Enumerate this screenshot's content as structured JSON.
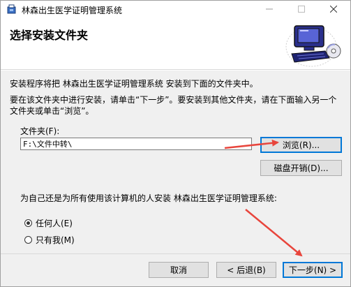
{
  "window": {
    "title": "林森出生医学证明管理系统",
    "icon": "installer-package-icon"
  },
  "header": {
    "title": "选择安装文件夹",
    "graphic_icon": "computer-cd-icon"
  },
  "body": {
    "intro": "安装程序将把 林森出生医学证明管理系统 安装到下面的文件夹中。",
    "description": "要在该文件夹中进行安装，请单击“下一步”。要安装到其他文件夹，请在下面输入另一个文件夹或单击“浏览”。",
    "folder_label": "文件夹(F):",
    "folder_value": "F:\\文件中转\\",
    "browse_label": "浏览(R)...",
    "disk_cost_label": "磁盘开销(D)...",
    "install_for_label": "为自己还是为所有使用该计算机的人安装 林森出生医学证明管理系统:",
    "radio_everyone": "任何人(E)",
    "radio_just_me": "只有我(M)",
    "selected_option": "everyone"
  },
  "footer": {
    "cancel_label": "取消",
    "back_label": "< 后退(B)",
    "next_label": "下一步(N) >"
  },
  "colors": {
    "accent": "#0078d7",
    "annotation_arrow": "#e8453c"
  }
}
